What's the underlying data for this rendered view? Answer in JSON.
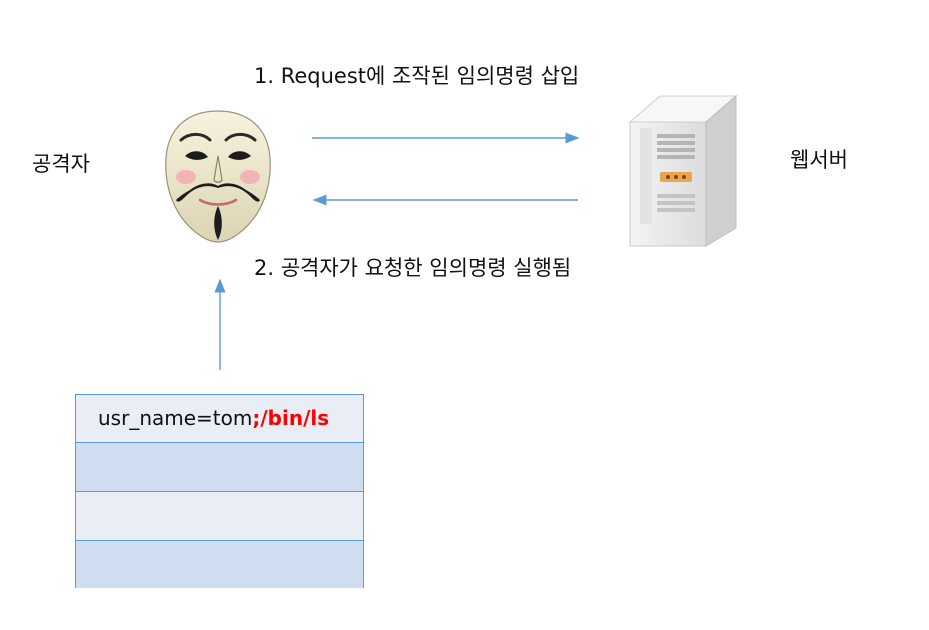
{
  "labels": {
    "attacker": "공격자",
    "server": "웹서버",
    "step1": "1. Request에 조작된 임의명령 삽입",
    "step2": "2. 공격자가 요청한 임의명령 실행됨"
  },
  "icons": {
    "attacker": "guy-fawkes-mask-icon",
    "server": "server-tower-icon"
  },
  "payload": {
    "param": "usr_name=tom",
    "injected": ";/bin/ls"
  },
  "colors": {
    "arrow": "#5b9bd5",
    "injected_text": "#ff0000",
    "table_border": "#5b9bd5",
    "row_light": "#e9edf6",
    "row_dark": "#d0dcf0"
  }
}
